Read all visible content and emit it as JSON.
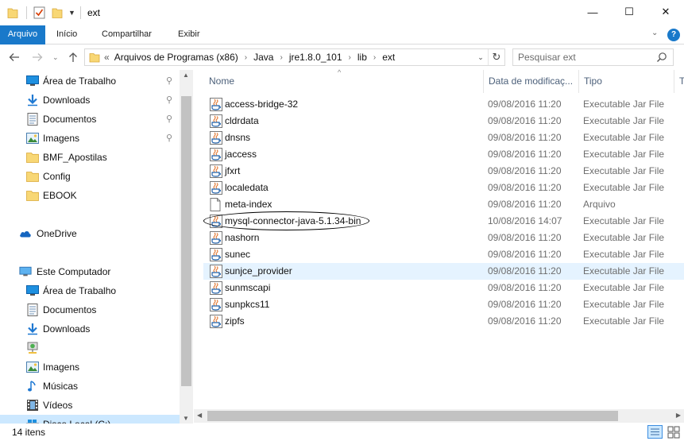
{
  "window": {
    "title": "ext",
    "minimize_glyph": "—",
    "maximize_glyph": "☐",
    "close_glyph": "✕"
  },
  "ribbon": {
    "tabs": [
      "Arquivo",
      "Início",
      "Compartilhar",
      "Exibir"
    ],
    "active_tab": "Arquivo",
    "accent": "#1979ca",
    "help_glyph": "?"
  },
  "address": {
    "lead": "«",
    "crumbs": [
      "Arquivos de Programas (x86)",
      "Java",
      "jre1.8.0_101",
      "lib",
      "ext"
    ]
  },
  "search": {
    "placeholder": "Pesquisar ext"
  },
  "nav_pane": {
    "items": [
      {
        "label": "Área de Trabalho",
        "icon": "desktop-icon",
        "pinned": true,
        "indent": 1
      },
      {
        "label": "Downloads",
        "icon": "download-icon",
        "pinned": true,
        "indent": 1
      },
      {
        "label": "Documentos",
        "icon": "document-icon",
        "pinned": true,
        "indent": 1
      },
      {
        "label": "Imagens",
        "icon": "images-icon",
        "pinned": true,
        "indent": 1
      },
      {
        "label": "BMF_Apostilas",
        "icon": "folder-icon",
        "pinned": false,
        "indent": 1
      },
      {
        "label": "Config",
        "icon": "folder-icon",
        "pinned": false,
        "indent": 1
      },
      {
        "label": "EBOOK",
        "icon": "folder-icon",
        "pinned": false,
        "indent": 1
      },
      {
        "label": "",
        "icon": "",
        "pinned": false,
        "indent": 0
      },
      {
        "label": "OneDrive",
        "icon": "onedrive-icon",
        "pinned": false,
        "indent": 0
      },
      {
        "label": "",
        "icon": "",
        "pinned": false,
        "indent": 0
      },
      {
        "label": "Este Computador",
        "icon": "computer-icon",
        "pinned": false,
        "indent": 0
      },
      {
        "label": "Área de Trabalho",
        "icon": "desktop-icon",
        "pinned": false,
        "indent": 1
      },
      {
        "label": "Documentos",
        "icon": "document-icon",
        "pinned": false,
        "indent": 1
      },
      {
        "label": "Downloads",
        "icon": "download-icon",
        "pinned": false,
        "indent": 1
      },
      {
        "label": "",
        "icon": "network-drive-icon",
        "pinned": false,
        "indent": 1
      },
      {
        "label": "Imagens",
        "icon": "images-icon",
        "pinned": false,
        "indent": 1
      },
      {
        "label": "Músicas",
        "icon": "music-icon",
        "pinned": false,
        "indent": 1
      },
      {
        "label": "Vídeos",
        "icon": "video-icon",
        "pinned": false,
        "indent": 1
      },
      {
        "label": "Disco Local (C:)",
        "icon": "disk-icon",
        "pinned": false,
        "indent": 1,
        "selected": true
      }
    ]
  },
  "columns": {
    "name": "Nome",
    "date": "Data de modificaç...",
    "type": "Tipo",
    "size": "T"
  },
  "files": [
    {
      "name": "access-bridge-32",
      "date": "09/08/2016 11:20",
      "type": "Executable Jar File",
      "icon": "jar-icon"
    },
    {
      "name": "cldrdata",
      "date": "09/08/2016 11:20",
      "type": "Executable Jar File",
      "icon": "jar-icon"
    },
    {
      "name": "dnsns",
      "date": "09/08/2016 11:20",
      "type": "Executable Jar File",
      "icon": "jar-icon"
    },
    {
      "name": "jaccess",
      "date": "09/08/2016 11:20",
      "type": "Executable Jar File",
      "icon": "jar-icon"
    },
    {
      "name": "jfxrt",
      "date": "09/08/2016 11:20",
      "type": "Executable Jar File",
      "icon": "jar-icon"
    },
    {
      "name": "localedata",
      "date": "09/08/2016 11:20",
      "type": "Executable Jar File",
      "icon": "jar-icon"
    },
    {
      "name": "meta-index",
      "date": "09/08/2016 11:20",
      "type": "Arquivo",
      "icon": "file-icon"
    },
    {
      "name": "mysql-connector-java-5.1.34-bin",
      "date": "10/08/2016 14:07",
      "type": "Executable Jar File",
      "icon": "jar-icon",
      "circled": true
    },
    {
      "name": "nashorn",
      "date": "09/08/2016 11:20",
      "type": "Executable Jar File",
      "icon": "jar-icon"
    },
    {
      "name": "sunec",
      "date": "09/08/2016 11:20",
      "type": "Executable Jar File",
      "icon": "jar-icon"
    },
    {
      "name": "sunjce_provider",
      "date": "09/08/2016 11:20",
      "type": "Executable Jar File",
      "icon": "jar-icon",
      "hover": true
    },
    {
      "name": "sunmscapi",
      "date": "09/08/2016 11:20",
      "type": "Executable Jar File",
      "icon": "jar-icon"
    },
    {
      "name": "sunpkcs11",
      "date": "09/08/2016 11:20",
      "type": "Executable Jar File",
      "icon": "jar-icon"
    },
    {
      "name": "zipfs",
      "date": "09/08/2016 11:20",
      "type": "Executable Jar File",
      "icon": "jar-icon"
    }
  ],
  "status": {
    "count_text": "14 itens"
  }
}
